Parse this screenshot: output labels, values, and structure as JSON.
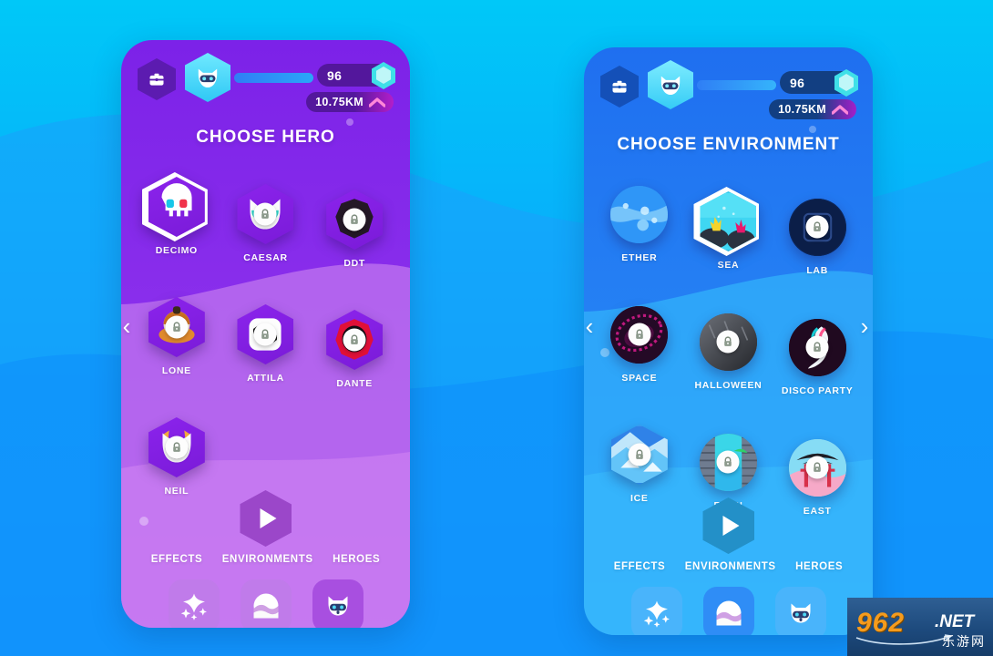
{
  "background": {
    "top_color": "#00c8f8",
    "bottom_color": "#0e8ffc",
    "wave_color": "#14a3fb"
  },
  "phones": [
    {
      "id": "hero-screen",
      "theme": {
        "bg_top": "#7c22e8",
        "bg_bottom": "#cc7ef0",
        "accent": "#8a2be2",
        "tile": "#8b23ec",
        "tile_dark": "#6c17c4",
        "play": "#9b47c9",
        "tab_card": "#c06ae6",
        "pill": "#5a1b9a"
      },
      "header": {
        "inventory_icon": "briefcase-icon",
        "avatar_icon": "hero-avatar-icon",
        "xp_bar_value": "",
        "coins": "96",
        "gem_icon": "gem-icon",
        "distance": "10.75KM",
        "distance_icon": "chevron-up-icon"
      },
      "title": "CHOOSE HERO",
      "items": [
        {
          "label": "DECIMO",
          "shape": "hex",
          "locked": false,
          "selected": true,
          "art": "skull-ghost-icon",
          "c1": "#8b23ec",
          "c2": "#7a1bd8"
        },
        {
          "label": "CAESAR",
          "shape": "hex",
          "locked": true,
          "selected": false,
          "art": "cat-face-icon",
          "c1": "#8b23ec",
          "c2": "#7a1bd8"
        },
        {
          "label": "DDT",
          "shape": "hex",
          "locked": true,
          "selected": false,
          "art": "dark-blob-icon",
          "c1": "#8b23ec",
          "c2": "#7a1bd8"
        },
        {
          "label": "LONE",
          "shape": "hex",
          "locked": true,
          "selected": false,
          "art": "orange-hero-icon",
          "c1": "#8b23ec",
          "c2": "#7a1bd8"
        },
        {
          "label": "ATTILA",
          "shape": "hex",
          "locked": true,
          "selected": false,
          "art": "white-square-icon",
          "c1": "#8b23ec",
          "c2": "#7a1bd8"
        },
        {
          "label": "DANTE",
          "shape": "hex",
          "locked": true,
          "selected": false,
          "art": "red-dark-icon",
          "c1": "#8b23ec",
          "c2": "#7a1bd8"
        },
        {
          "label": "NEIL",
          "shape": "hex",
          "locked": true,
          "selected": false,
          "art": "helmet-cat-icon",
          "c1": "#8b23ec",
          "c2": "#7a1bd8"
        }
      ],
      "play_button": "play-icon",
      "tabs": [
        {
          "label": "EFFECTS",
          "icon": "sparkle-icon",
          "active": false
        },
        {
          "label": "ENVIRONMENTS",
          "icon": "landscape-icon",
          "active": false
        },
        {
          "label": "HEROES",
          "icon": "robot-cat-icon",
          "active": true
        }
      ],
      "nav": {
        "left": "chevron-left-icon",
        "right": ""
      }
    },
    {
      "id": "environment-screen",
      "theme": {
        "bg_top": "#1f6ff0",
        "bg_bottom": "#2fb6fb",
        "accent": "#1d7ff5",
        "tile": "#2b84f5",
        "tile_dark": "#1c5fd6",
        "play": "#2390c8",
        "tab_card": "#3eb0fa",
        "pill": "#123f82"
      },
      "header": {
        "inventory_icon": "briefcase-icon",
        "avatar_icon": "hero-avatar-icon",
        "xp_bar_value": "",
        "coins": "96",
        "gem_icon": "gem-icon",
        "distance": "10.75KM",
        "distance_icon": "chevron-up-icon"
      },
      "title": "CHOOSE ENVIRONMENT",
      "items": [
        {
          "label": "ETHER",
          "shape": "circ",
          "locked": false,
          "selected": false,
          "art": "ether-icon",
          "c1": "#2f96f7",
          "c2": "#1f77e8"
        },
        {
          "label": "SEA",
          "shape": "hex",
          "locked": false,
          "selected": true,
          "art": "sea-icon",
          "c1": "#3ad0f0",
          "c2": "#2ab6e4"
        },
        {
          "label": "LAB",
          "shape": "circ",
          "locked": true,
          "selected": false,
          "art": "lab-icon",
          "c1": "#0d2557",
          "c2": "#081a3d"
        },
        {
          "label": "SPACE",
          "shape": "circ",
          "locked": true,
          "selected": false,
          "art": "space-icon",
          "c1": "#2a0b2b",
          "c2": "#170515"
        },
        {
          "label": "HALLOWEEN",
          "shape": "circ",
          "locked": true,
          "selected": false,
          "art": "halloween-icon",
          "c1": "#5e6168",
          "c2": "#2b2d33"
        },
        {
          "label": "DISCO PARTY",
          "shape": "circ",
          "locked": true,
          "selected": false,
          "art": "disco-icon",
          "c1": "#220b22",
          "c2": "#120512"
        },
        {
          "label": "ICE",
          "shape": "hex",
          "locked": true,
          "selected": false,
          "art": "ice-icon",
          "c1": "#3a9cf0",
          "c2": "#2b84e0"
        },
        {
          "label": "EDEN",
          "shape": "circ",
          "locked": true,
          "selected": false,
          "art": "eden-icon",
          "c1": "#46d8c8",
          "c2": "#2fb6b0"
        },
        {
          "label": "EAST",
          "shape": "circ",
          "locked": true,
          "selected": false,
          "art": "east-icon",
          "c1": "#7fd8f2",
          "c2": "#f2a8c4"
        }
      ],
      "play_button": "play-icon",
      "tabs": [
        {
          "label": "EFFECTS",
          "icon": "sparkle-icon",
          "active": false
        },
        {
          "label": "ENVIRONMENTS",
          "icon": "landscape-icon",
          "active": true
        },
        {
          "label": "HEROES",
          "icon": "robot-cat-icon",
          "active": false
        }
      ],
      "nav": {
        "left": "chevron-left-icon",
        "right": "chevron-right-icon"
      }
    }
  ],
  "watermark": {
    "brand": "962",
    "tld": ".NET",
    "subtitle": "乐游网"
  }
}
